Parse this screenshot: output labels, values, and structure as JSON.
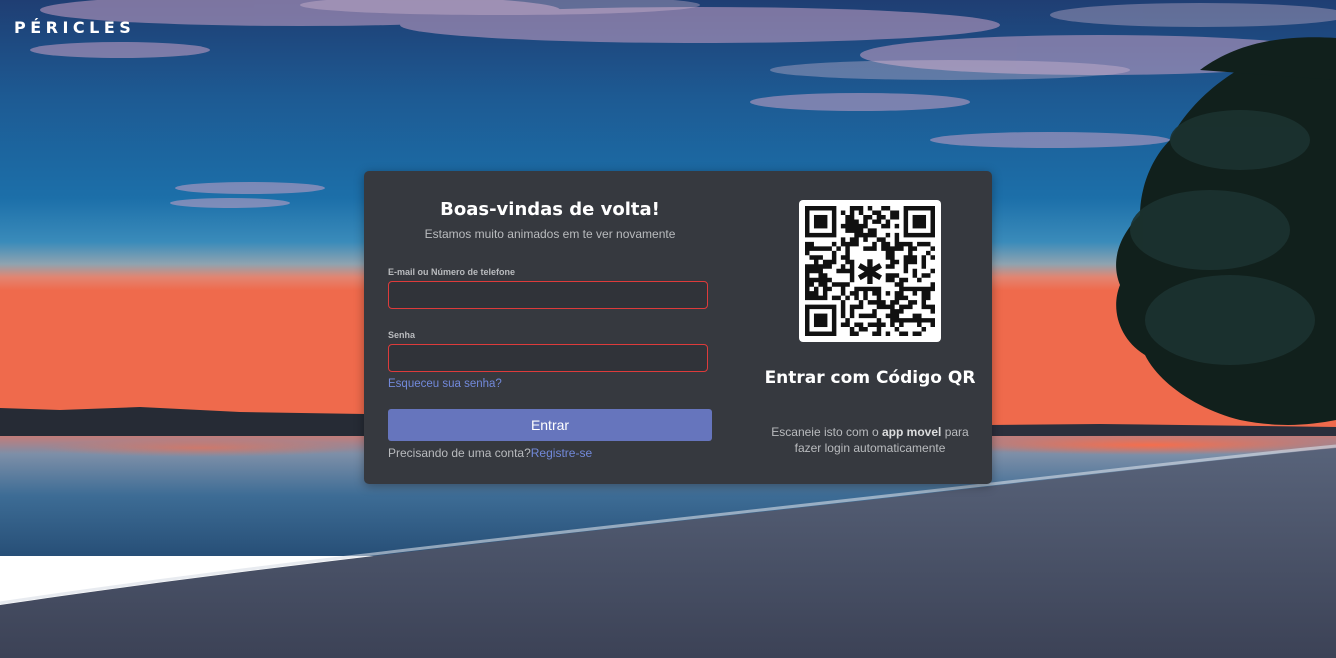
{
  "brand": {
    "name": "PÉRICLES"
  },
  "login": {
    "title": "Boas-vindas de volta!",
    "subtitle": "Estamos muito animados em te ver novamente",
    "email_label": "E-mail ou Número de telefone",
    "email_value": "",
    "password_label": "Senha",
    "password_value": "",
    "forgot_link": "Esqueceu sua senha?",
    "submit_label": "Entrar",
    "register_prompt": "Precisando de uma conta?",
    "register_link": "Registre-se"
  },
  "qr": {
    "title": "Entrar com Código QR",
    "desc_before": "Escaneie isto com o ",
    "desc_bold": "app movel",
    "desc_after": " para fazer login automaticamente",
    "center_icon": "asterisk-logo-icon"
  },
  "colors": {
    "card_background": "#36393f",
    "accent": "#6675bd",
    "link": "#7289da",
    "input_border_error": "#dd3b3b"
  },
  "background": {
    "scene": "beach-sunset-photo"
  }
}
